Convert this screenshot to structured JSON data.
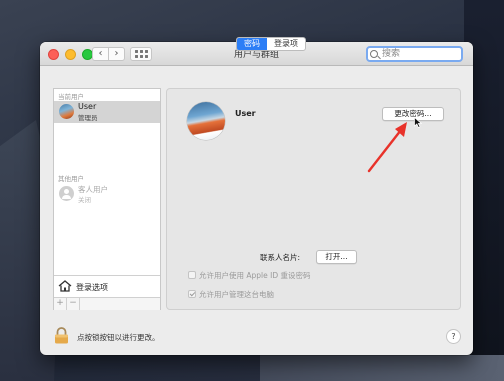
{
  "window": {
    "title": "用户与群组",
    "search_placeholder": "搜索",
    "nav_back": "‹",
    "nav_forward": "›"
  },
  "sidebar": {
    "current_users_header": "当前用户",
    "current_user": {
      "name": "User",
      "role": "管理员"
    },
    "other_users_header": "其他用户",
    "guest_user": {
      "name": "客人用户",
      "state": "关闭"
    },
    "login_options_label": "登录选项",
    "add_label": "+",
    "remove_label": "−"
  },
  "main": {
    "tabs": [
      {
        "label": "密码",
        "active": true
      },
      {
        "label": "登录项",
        "active": false
      }
    ],
    "username": "User",
    "change_password_button": "更改密码...",
    "contact_card_label": "联系人名片:",
    "open_button": "打开...",
    "checkbox_apple_id": {
      "label": "允许用户使用 Apple ID 重设密码",
      "checked": false
    },
    "checkbox_admin": {
      "label": "允许用户管理这台电脑",
      "checked": true
    }
  },
  "footer": {
    "lock_text": "点按锁按钮以进行更改。",
    "help_label": "?"
  },
  "colors": {
    "accent": "#2c7ef6",
    "annotation_arrow": "#e8322a",
    "close": "#fc5f57",
    "minimize": "#fdbc2e",
    "maximize": "#28c840"
  }
}
